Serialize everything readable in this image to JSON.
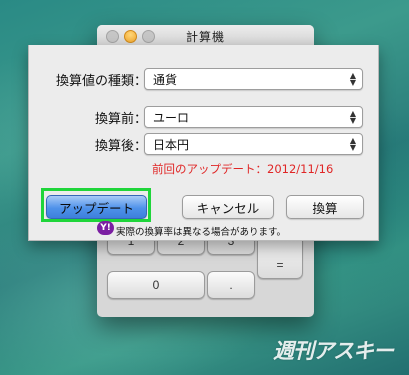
{
  "window": {
    "title": "計算機"
  },
  "keypad": {
    "row_top": [
      "1",
      "2",
      "3"
    ],
    "zero": "0",
    "decimal": ".",
    "equals": "="
  },
  "dialog": {
    "conversion_type_label": "換算値の種類：",
    "conversion_type_value": "通貨",
    "from_label": "換算前：",
    "from_value": "ユーロ",
    "to_label": "換算後：",
    "to_value": "日本円",
    "last_update_notice": "前回のアップデート：2012/11/16",
    "update_button": "アップデート",
    "cancel_button": "キャンセル",
    "convert_button": "換算",
    "footer_note": "実際の換算率は異なる場合があります。",
    "yahoo_logo_text": "Y!"
  },
  "watermark": "週刊アスキー",
  "colors": {
    "notice_text": "#e02626",
    "highlight_border": "#1fd53a",
    "default_button": "#4f92ea",
    "desktop": "#2a8a85"
  }
}
